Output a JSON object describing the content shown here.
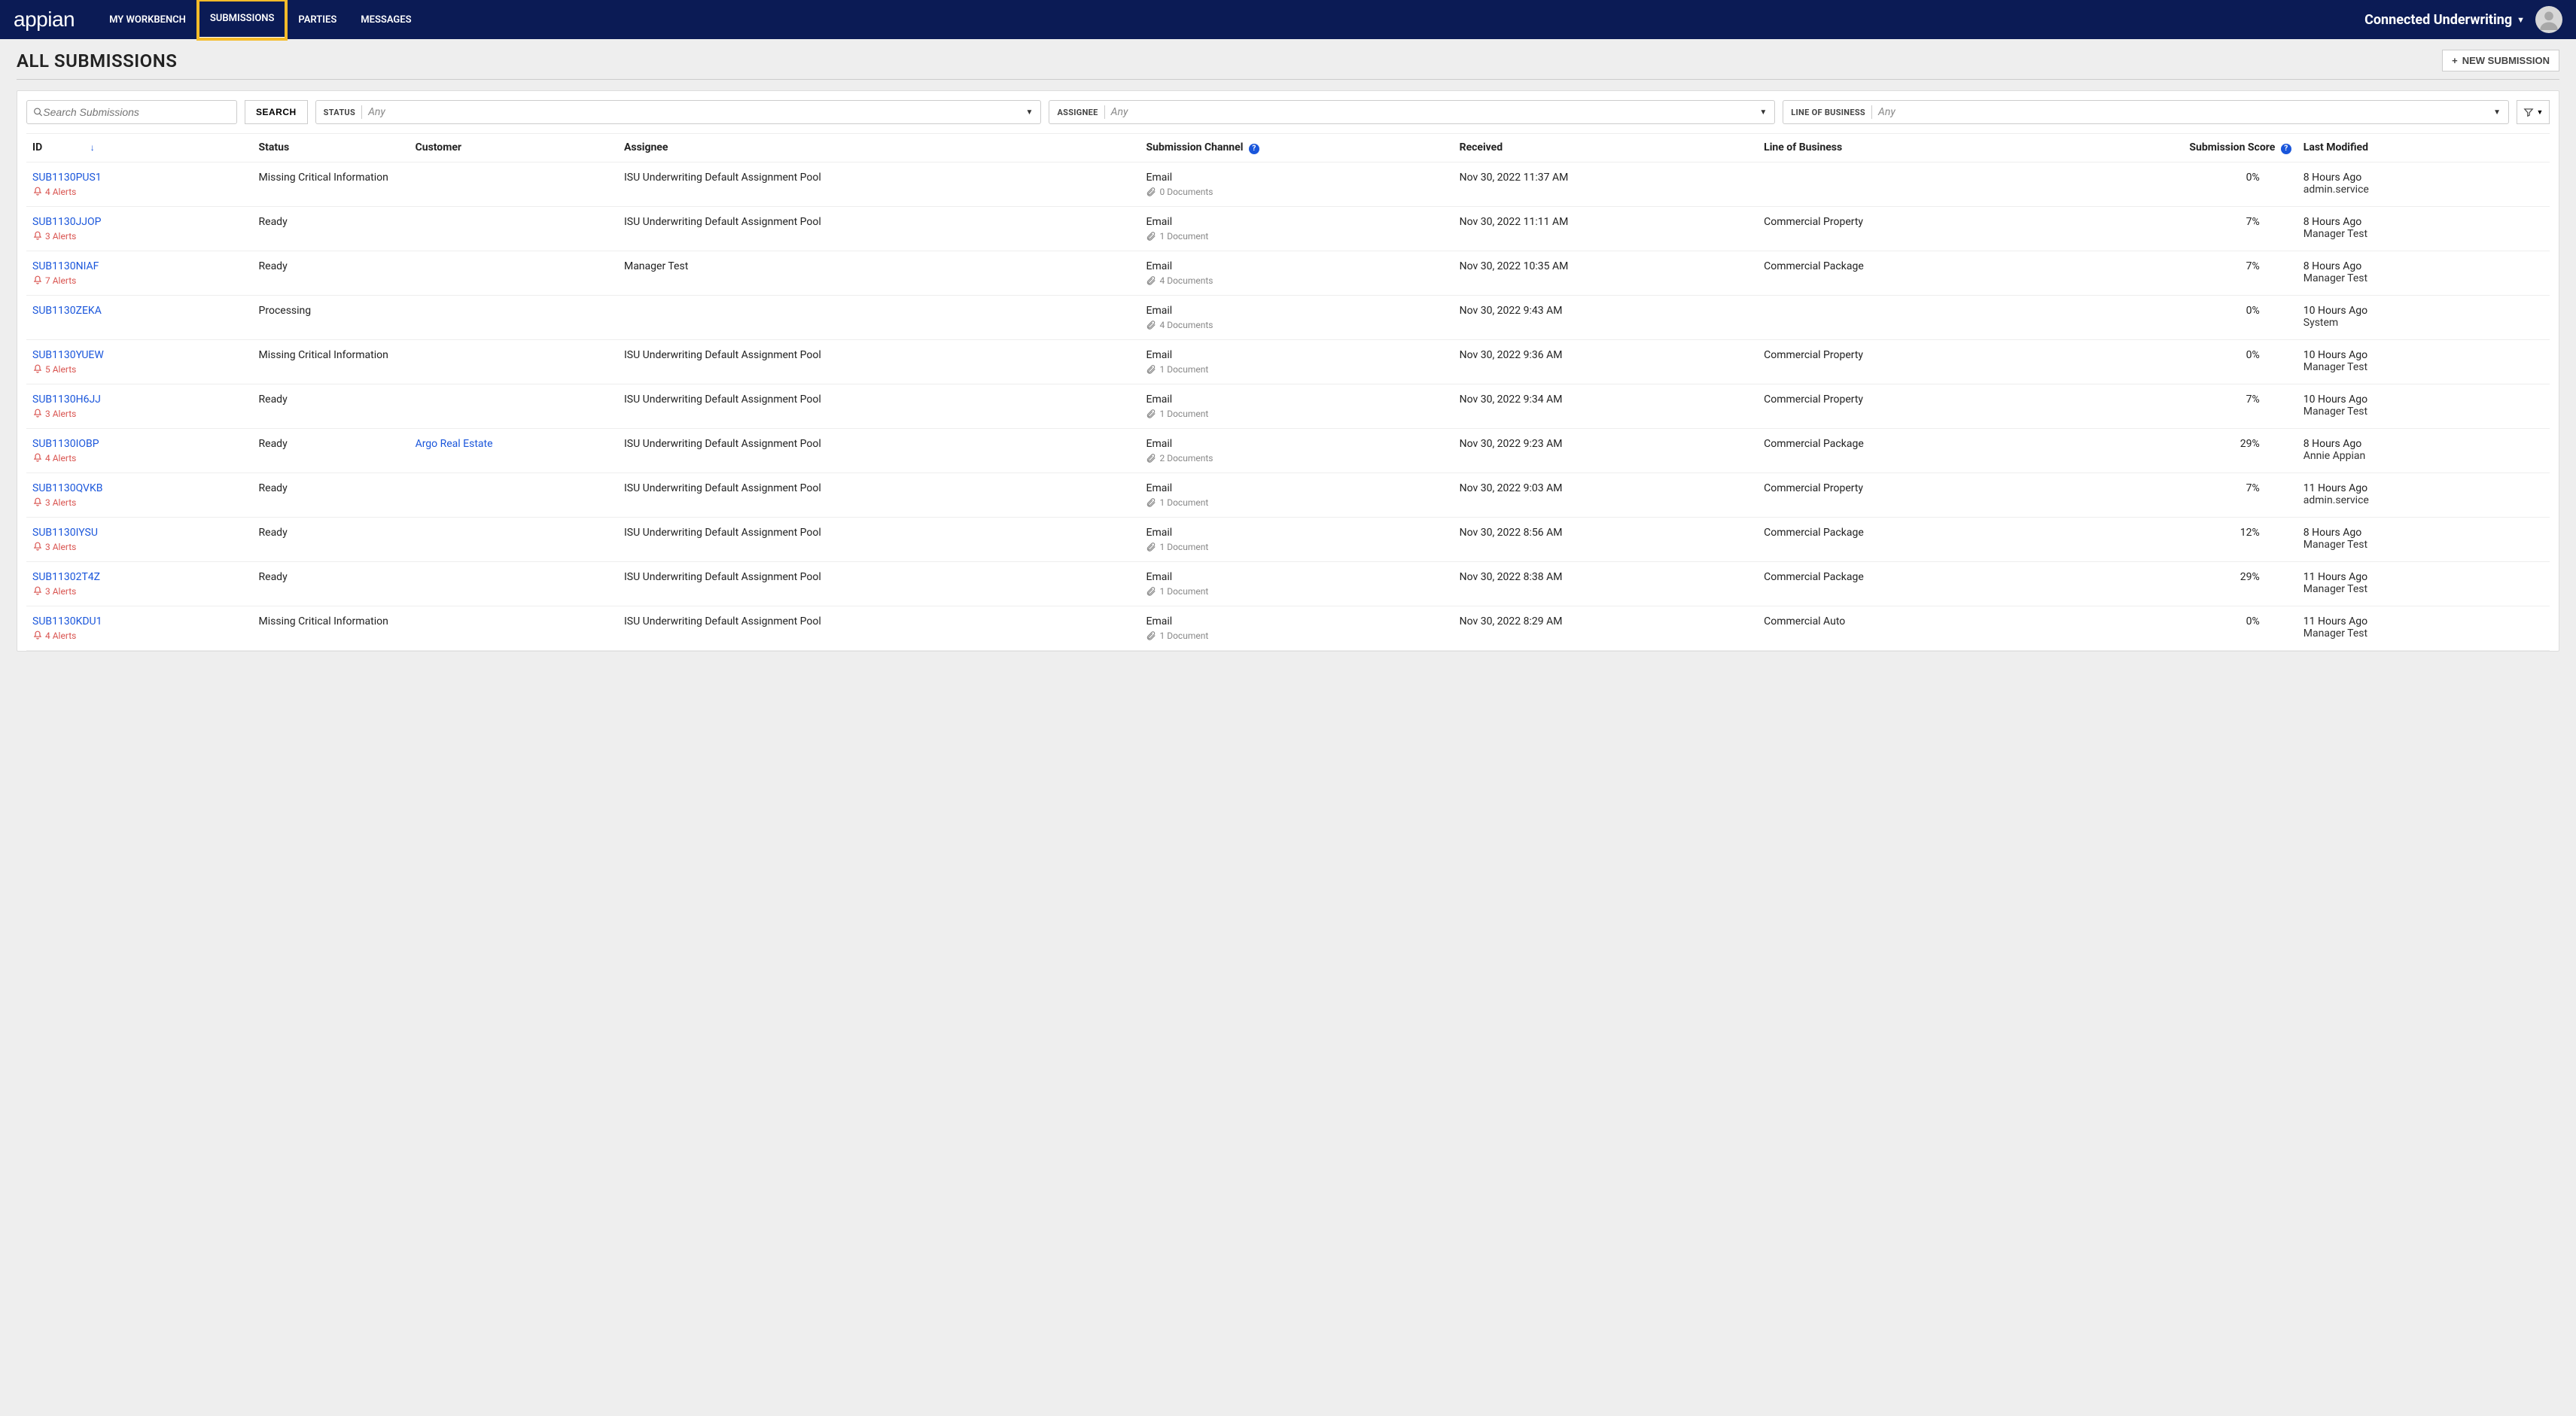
{
  "brand": "appian",
  "nav": {
    "tabs": [
      {
        "label": "MY WORKBENCH",
        "active": false
      },
      {
        "label": "SUBMISSIONS",
        "active": true,
        "highlighted": true
      },
      {
        "label": "PARTIES",
        "active": false
      },
      {
        "label": "MESSAGES",
        "active": false
      }
    ],
    "workspace": "Connected Underwriting"
  },
  "page": {
    "title": "ALL SUBMISSIONS",
    "new_button": "NEW SUBMISSION"
  },
  "filters": {
    "search_placeholder": "Search Submissions",
    "search_button": "SEARCH",
    "status_label": "STATUS",
    "status_value": "Any",
    "assignee_label": "ASSIGNEE",
    "assignee_value": "Any",
    "lob_label": "LINE OF BUSINESS",
    "lob_value": "Any"
  },
  "columns": {
    "id": "ID",
    "status": "Status",
    "customer": "Customer",
    "assignee": "Assignee",
    "channel": "Submission Channel",
    "received": "Received",
    "lob": "Line of Business",
    "score": "Submission Score",
    "modified": "Last Modified"
  },
  "alerts_word": "Alerts",
  "rows": [
    {
      "id": "SUB1130PUS1",
      "alerts": 4,
      "status": "Missing Critical Information",
      "customer": "",
      "assignee": "ISU Underwriting Default Assignment Pool",
      "channel": "Email",
      "docs": "0 Documents",
      "received": "Nov 30, 2022 11:37 AM",
      "lob": "",
      "score": "0%",
      "modified": "8 Hours Ago",
      "modified_by": "admin.service"
    },
    {
      "id": "SUB1130JJOP",
      "alerts": 3,
      "status": "Ready",
      "customer": "",
      "assignee": "ISU Underwriting Default Assignment Pool",
      "channel": "Email",
      "docs": "1 Document",
      "received": "Nov 30, 2022 11:11 AM",
      "lob": "Commercial Property",
      "score": "7%",
      "modified": "8 Hours Ago",
      "modified_by": "Manager Test"
    },
    {
      "id": "SUB1130NIAF",
      "alerts": 7,
      "status": "Ready",
      "customer": "",
      "assignee": "Manager Test",
      "channel": "Email",
      "docs": "4 Documents",
      "received": "Nov 30, 2022 10:35 AM",
      "lob": "Commercial Package",
      "score": "7%",
      "modified": "8 Hours Ago",
      "modified_by": "Manager Test"
    },
    {
      "id": "SUB1130ZEKA",
      "alerts": null,
      "status": "Processing",
      "customer": "",
      "assignee": "",
      "channel": "Email",
      "docs": "4 Documents",
      "received": "Nov 30, 2022 9:43 AM",
      "lob": "",
      "score": "0%",
      "modified": "10 Hours Ago",
      "modified_by": "System"
    },
    {
      "id": "SUB1130YUEW",
      "alerts": 5,
      "status": "Missing Critical Information",
      "customer": "",
      "assignee": "ISU Underwriting Default Assignment Pool",
      "channel": "Email",
      "docs": "1 Document",
      "received": "Nov 30, 2022 9:36 AM",
      "lob": "Commercial Property",
      "score": "0%",
      "modified": "10 Hours Ago",
      "modified_by": "Manager Test"
    },
    {
      "id": "SUB1130H6JJ",
      "alerts": 3,
      "status": "Ready",
      "customer": "",
      "assignee": "ISU Underwriting Default Assignment Pool",
      "channel": "Email",
      "docs": "1 Document",
      "received": "Nov 30, 2022 9:34 AM",
      "lob": "Commercial Property",
      "score": "7%",
      "modified": "10 Hours Ago",
      "modified_by": "Manager Test"
    },
    {
      "id": "SUB1130IOBP",
      "alerts": 4,
      "status": "Ready",
      "customer": "Argo Real Estate",
      "assignee": "ISU Underwriting Default Assignment Pool",
      "channel": "Email",
      "docs": "2 Documents",
      "received": "Nov 30, 2022 9:23 AM",
      "lob": "Commercial Package",
      "score": "29%",
      "modified": "8 Hours Ago",
      "modified_by": "Annie Appian"
    },
    {
      "id": "SUB1130QVKB",
      "alerts": 3,
      "status": "Ready",
      "customer": "",
      "assignee": "ISU Underwriting Default Assignment Pool",
      "channel": "Email",
      "docs": "1 Document",
      "received": "Nov 30, 2022 9:03 AM",
      "lob": "Commercial Property",
      "score": "7%",
      "modified": "11 Hours Ago",
      "modified_by": "admin.service"
    },
    {
      "id": "SUB1130IYSU",
      "alerts": 3,
      "status": "Ready",
      "customer": "",
      "assignee": "ISU Underwriting Default Assignment Pool",
      "channel": "Email",
      "docs": "1 Document",
      "received": "Nov 30, 2022 8:56 AM",
      "lob": "Commercial Package",
      "score": "12%",
      "modified": "8 Hours Ago",
      "modified_by": "Manager Test"
    },
    {
      "id": "SUB11302T4Z",
      "alerts": 3,
      "status": "Ready",
      "customer": "",
      "assignee": "ISU Underwriting Default Assignment Pool",
      "channel": "Email",
      "docs": "1 Document",
      "received": "Nov 30, 2022 8:38 AM",
      "lob": "Commercial Package",
      "score": "29%",
      "modified": "11 Hours Ago",
      "modified_by": "Manager Test"
    },
    {
      "id": "SUB1130KDU1",
      "alerts": 4,
      "status": "Missing Critical Information",
      "customer": "",
      "assignee": "ISU Underwriting Default Assignment Pool",
      "channel": "Email",
      "docs": "1 Document",
      "received": "Nov 30, 2022 8:29 AM",
      "lob": "Commercial Auto",
      "score": "0%",
      "modified": "11 Hours Ago",
      "modified_by": "Manager Test"
    }
  ]
}
